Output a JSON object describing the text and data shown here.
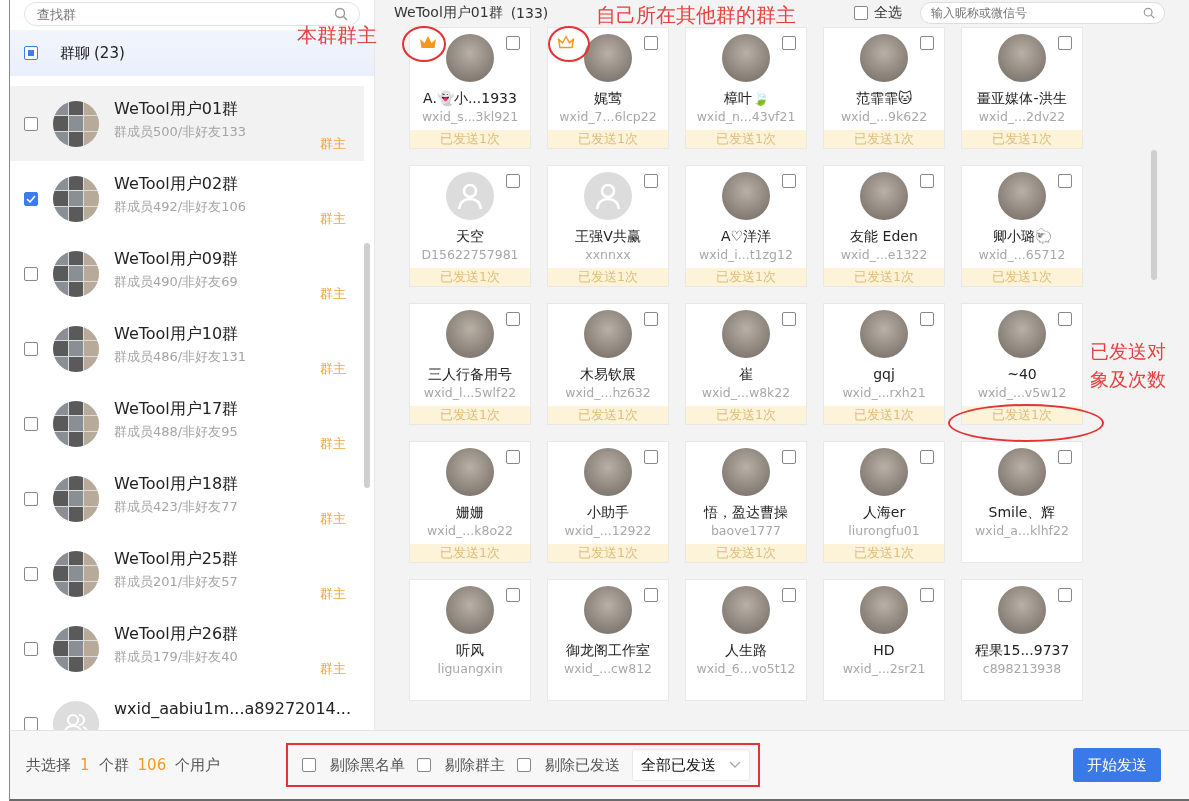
{
  "groups_panel": {
    "search": {
      "placeholder": "查找群"
    },
    "header": {
      "label": "群聊",
      "count": "(23)",
      "checked": true,
      "partial": true
    },
    "groups": [
      {
        "name": "WeTool用户01群",
        "members": "群成员500/非好友133",
        "role": "群主",
        "checked": false,
        "highlighted": true,
        "kind": "collage"
      },
      {
        "name": "WeTool用户02群",
        "members": "群成员492/非好友106",
        "role": "群主",
        "checked": true,
        "highlighted": false,
        "kind": "collage"
      },
      {
        "name": "WeTool用户09群",
        "members": "群成员490/非好友69",
        "role": "群主",
        "checked": false,
        "highlighted": false,
        "kind": "collage"
      },
      {
        "name": "WeTool用户10群",
        "members": "群成员486/非好友131",
        "role": "群主",
        "checked": false,
        "highlighted": false,
        "kind": "collage"
      },
      {
        "name": "WeTool用户17群",
        "members": "群成员488/非好友95",
        "role": "群主",
        "checked": false,
        "highlighted": false,
        "kind": "collage"
      },
      {
        "name": "WeTool用户18群",
        "members": "群成员423/非好友77",
        "role": "群主",
        "checked": false,
        "highlighted": false,
        "kind": "collage"
      },
      {
        "name": "WeTool用户25群",
        "members": "群成员201/非好友57",
        "role": "群主",
        "checked": false,
        "highlighted": false,
        "kind": "collage"
      },
      {
        "name": "WeTool用户26群",
        "members": "群成员179/非好友40",
        "role": "群主",
        "checked": false,
        "highlighted": false,
        "kind": "collage"
      },
      {
        "name": "wxid_aabiu1m...a89272014...",
        "checked": false,
        "highlighted": false,
        "kind": "default"
      }
    ]
  },
  "members_panel": {
    "title": "WeTool用户01群",
    "count": "(133)",
    "select_all": {
      "label": "全选",
      "checked": false
    },
    "search": {
      "placeholder": "输入昵称或微信号"
    },
    "members": [
      {
        "name": "A.👻小...1933",
        "id": "wxid_s...3kl921",
        "sent": "已发送1次",
        "owner_here": true,
        "owner_elsewhere": false,
        "kind": "photo",
        "checked": false
      },
      {
        "name": "娓莺",
        "id": "wxid_7...6lcp22",
        "sent": "已发送1次",
        "owner_here": false,
        "owner_elsewhere": true,
        "kind": "photo",
        "checked": false
      },
      {
        "name": "樟叶🍃",
        "id": "wxid_n...43vf21",
        "sent": "已发送1次",
        "owner_here": false,
        "owner_elsewhere": false,
        "kind": "photo",
        "checked": false
      },
      {
        "name": "范霏霏🐱",
        "id": "wxid_...9k622",
        "sent": "已发送1次",
        "owner_here": false,
        "owner_elsewhere": false,
        "kind": "photo",
        "checked": false
      },
      {
        "name": "畺亚媒体-洪生",
        "id": "wxid_...2dv22",
        "sent": "已发送1次",
        "owner_here": false,
        "owner_elsewhere": false,
        "kind": "photo",
        "checked": false
      },
      {
        "name": "天空",
        "id": "D15622757981",
        "sent": "已发送1次",
        "owner_here": false,
        "owner_elsewhere": false,
        "kind": "default",
        "checked": false
      },
      {
        "name": "王强V共赢",
        "id": "xxnnxx",
        "sent": "已发送1次",
        "owner_here": false,
        "owner_elsewhere": false,
        "kind": "default",
        "checked": false
      },
      {
        "name": "A♡洋洋",
        "id": "wxid_i...t1zg12",
        "sent": "已发送1次",
        "owner_here": false,
        "owner_elsewhere": false,
        "kind": "photo",
        "checked": false
      },
      {
        "name": "友能 Eden",
        "id": "wxid_...e1322",
        "sent": "已发送1次",
        "owner_here": false,
        "owner_elsewhere": false,
        "kind": "photo",
        "checked": false
      },
      {
        "name": "卿小璐🐑",
        "id": "wxid_...65712",
        "sent": "已发送1次",
        "owner_here": false,
        "owner_elsewhere": false,
        "kind": "photo",
        "checked": false
      },
      {
        "name": "三人行备用号",
        "id": "wxid_l...5wlf22",
        "sent": "已发送1次",
        "owner_here": false,
        "owner_elsewhere": false,
        "kind": "photo",
        "checked": false
      },
      {
        "name": "木易钦展",
        "id": "wxid_...hz632",
        "sent": "已发送1次",
        "owner_here": false,
        "owner_elsewhere": false,
        "kind": "photo",
        "checked": false
      },
      {
        "name": "崔",
        "id": "wxid_...w8k22",
        "sent": "已发送1次",
        "owner_here": false,
        "owner_elsewhere": false,
        "kind": "photo",
        "checked": false
      },
      {
        "name": "gqj",
        "id": "wxid_...rxh21",
        "sent": "已发送1次",
        "owner_here": false,
        "owner_elsewhere": false,
        "kind": "photo",
        "checked": false
      },
      {
        "name": "~40",
        "id": "wxid_...v5w12",
        "sent": "已发送1次",
        "owner_here": false,
        "owner_elsewhere": false,
        "kind": "photo",
        "checked": false
      },
      {
        "name": "姗姗",
        "id": "wxid_...k8o22",
        "sent": "已发送1次",
        "owner_here": false,
        "owner_elsewhere": false,
        "kind": "photo",
        "checked": false
      },
      {
        "name": "小助手",
        "id": "wxid_...12922",
        "sent": "已发送1次",
        "owner_here": false,
        "owner_elsewhere": false,
        "kind": "photo",
        "checked": false
      },
      {
        "name": "悟，盈达曹操",
        "id": "baove1777",
        "sent": "已发送1次",
        "owner_here": false,
        "owner_elsewhere": false,
        "kind": "photo",
        "checked": false
      },
      {
        "name": "人海er",
        "id": "liurongfu01",
        "sent": "已发送1次",
        "owner_here": false,
        "owner_elsewhere": false,
        "kind": "photo",
        "checked": false
      },
      {
        "name": "Smile、辉",
        "id": "wxid_a...klhf22",
        "owner_here": false,
        "owner_elsewhere": false,
        "kind": "photo",
        "checked": false
      },
      {
        "name": "听风",
        "id": "liguangxin",
        "owner_here": false,
        "owner_elsewhere": false,
        "kind": "photo",
        "checked": false
      },
      {
        "name": "御龙阁工作室",
        "id": "wxid_...cw812",
        "owner_here": false,
        "owner_elsewhere": false,
        "kind": "photo",
        "checked": false
      },
      {
        "name": "人生路",
        "id": "wxid_6...vo5t12",
        "owner_here": false,
        "owner_elsewhere": false,
        "kind": "photo",
        "checked": false
      },
      {
        "name": "HD",
        "id": "wxid_...2sr21",
        "owner_here": false,
        "owner_elsewhere": false,
        "kind": "photo",
        "checked": false
      },
      {
        "name": "程果15...9737",
        "id": "c898213938",
        "owner_here": false,
        "owner_elsewhere": false,
        "kind": "photo",
        "checked": false
      }
    ]
  },
  "bottom_bar": {
    "summary": [
      {
        "text": "共选择",
        "kind": "label"
      },
      {
        "text": "1",
        "kind": "count"
      },
      {
        "text": "个群",
        "kind": "label"
      },
      {
        "text": "106",
        "kind": "count"
      },
      {
        "text": "个用户",
        "kind": "label"
      }
    ],
    "options": [
      {
        "label": "剔除黑名单",
        "checked": false
      },
      {
        "label": "剔除群主",
        "checked": false
      },
      {
        "label": "剔除已发送",
        "checked": false
      }
    ],
    "dropdown": {
      "value": "全部已发送"
    },
    "button": "开始发送"
  },
  "annotations": [
    {
      "text": "本群群主"
    },
    {
      "text": "自己所在其他群的群主"
    },
    {
      "text": "已发送对象及次数"
    }
  ]
}
